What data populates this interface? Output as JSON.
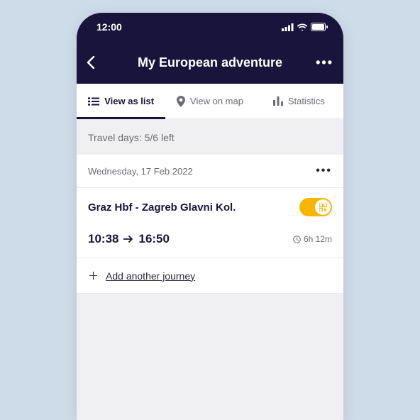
{
  "status": {
    "time": "12:00"
  },
  "header": {
    "title": "My European adventure"
  },
  "tabs": {
    "list": "View as list",
    "map": "View on map",
    "stats": "Statistics"
  },
  "travel_days": "Travel days: 5/6 left",
  "day": {
    "date": "Wednesday, 17 Feb 2022"
  },
  "journey": {
    "route": "Graz Hbf - Zagreb Glavni Kol.",
    "depart": "10:38",
    "arrive": "16:50",
    "duration": "6h 12m"
  },
  "add": "Add another journey"
}
